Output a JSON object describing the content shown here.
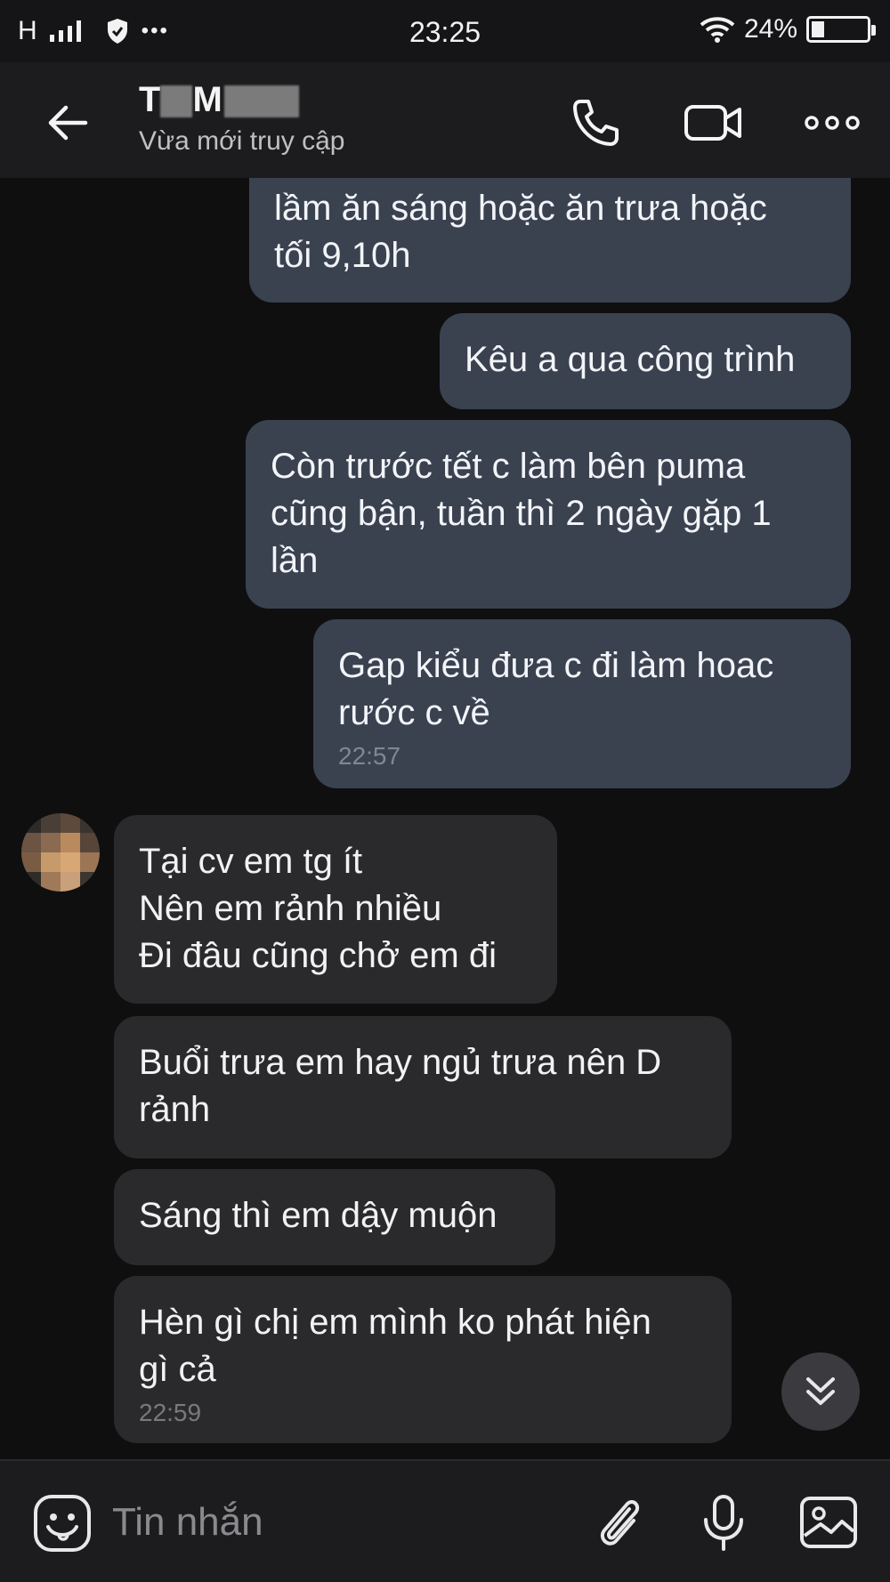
{
  "status_bar": {
    "network": "H",
    "time": "23:25",
    "battery_percent": "24%",
    "battery_level": 0.24,
    "more": "•••"
  },
  "header": {
    "contact_name_initial_1": "T",
    "contact_name_initial_2": "M",
    "contact_status": "Vừa mới truy cập"
  },
  "messages": [
    {
      "direction": "out",
      "lines": [
        "lầm ăn sáng hoặc ăn trưa hoặc",
        "tối 9,10h"
      ],
      "time": ""
    },
    {
      "direction": "out",
      "lines": [
        "Kêu a qua công trình"
      ],
      "time": ""
    },
    {
      "direction": "out",
      "lines": [
        "Còn trước tết c làm bên puma",
        "cũng bận, tuần thì 2 ngày gặp 1",
        "lần"
      ],
      "time": ""
    },
    {
      "direction": "out",
      "lines": [
        "Gap kiểu đưa c đi làm hoac",
        "rước c về"
      ],
      "time": "22:57"
    },
    {
      "direction": "in",
      "lines": [
        "Tại cv em tg ít",
        "Nên em rảnh nhiều",
        "Đi đâu cũng chở em đi"
      ],
      "time": ""
    },
    {
      "direction": "in",
      "lines": [
        "Buổi trưa em hay ngủ trưa nên D",
        "rảnh"
      ],
      "time": ""
    },
    {
      "direction": "in",
      "lines": [
        "Sáng thì em dậy muộn"
      ],
      "time": ""
    },
    {
      "direction": "in",
      "lines": [
        "Hèn gì chị em mình ko phát hiện",
        "gì cả"
      ],
      "time": "22:59"
    }
  ],
  "composer": {
    "placeholder": "Tin nhắn"
  },
  "colors": {
    "background": "#0f0f10",
    "outgoing_bubble": "#3a4250",
    "incoming_bubble": "#2a2a2c",
    "header": "#1c1c1e"
  },
  "icons": {
    "back": "back-arrow-icon",
    "call": "phone-icon",
    "video": "video-camera-icon",
    "menu": "more-options-icon",
    "scroll": "double-chevron-down-icon",
    "emoji": "sticker-emoji-icon",
    "attach": "paperclip-icon",
    "mic": "microphone-icon",
    "image": "image-gallery-icon"
  }
}
